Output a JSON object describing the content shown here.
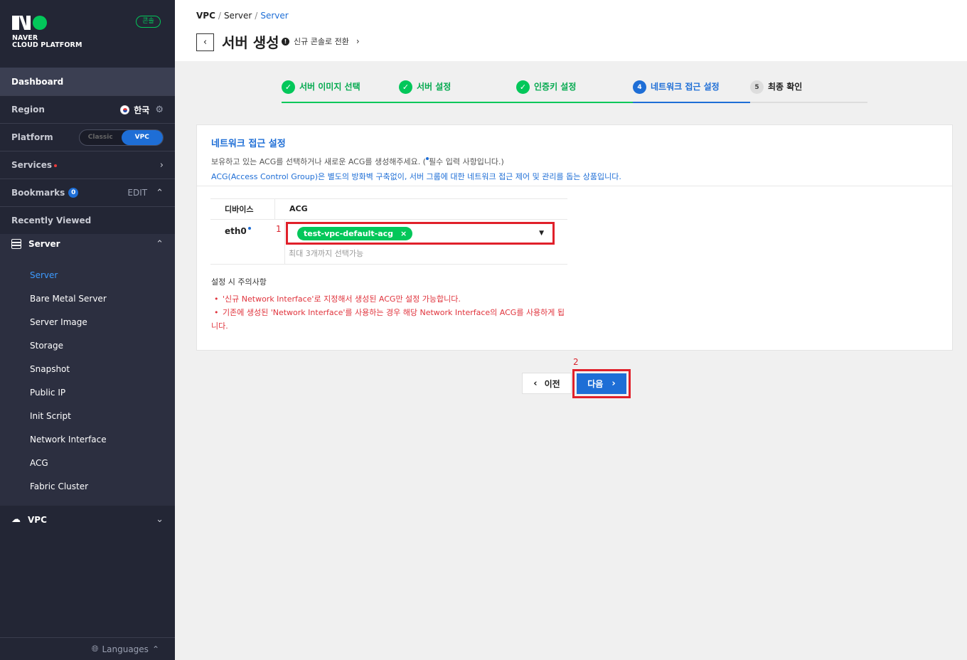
{
  "brand": {
    "line1": "NAVER",
    "line2": "CLOUD PLATFORM",
    "console_badge": "콘솔"
  },
  "sidebar": {
    "dashboard": "Dashboard",
    "region_label": "Region",
    "region_value": "한국",
    "platform_label": "Platform",
    "platform_options": [
      "Classic",
      "VPC"
    ],
    "platform_selected": "VPC",
    "services_label": "Services",
    "bookmarks_label": "Bookmarks",
    "bookmarks_count": "0",
    "bookmarks_edit": "EDIT",
    "recently_viewed": "Recently Viewed",
    "server_group": "Server",
    "server_items": [
      "Server",
      "Bare Metal Server",
      "Server Image",
      "Storage",
      "Snapshot",
      "Public IP",
      "Init Script",
      "Network Interface",
      "ACG",
      "Fabric Cluster"
    ],
    "server_active": "Server",
    "vpc_group": "VPC",
    "languages": "Languages"
  },
  "header": {
    "breadcrumb": [
      "VPC",
      "Server",
      "Server"
    ],
    "title": "서버 생성",
    "switch_console": "신규 콘솔로 전환"
  },
  "stepper": {
    "steps": [
      {
        "num": "1",
        "label": "서버 이미지 선택",
        "state": "done"
      },
      {
        "num": "2",
        "label": "서버 설정",
        "state": "done"
      },
      {
        "num": "3",
        "label": "인증키 설정",
        "state": "done"
      },
      {
        "num": "4",
        "label": "네트워크 접근 설정",
        "state": "current"
      },
      {
        "num": "5",
        "label": "최종 확인",
        "state": "todo"
      }
    ]
  },
  "card": {
    "title": "네트워크 접근 설정",
    "desc1_a": "보유하고 있는 ACG를 선택하거나 새로운 ACG를 생성해주세요. (",
    "desc1_b": "필수 입력 사항입니다.)",
    "desc2": "ACG(Access Control Group)은 별도의 방화벽 구축없이, 서버 그룹에 대한 네트워크 접근 제어 및 관리를 돕는 상품입니다.",
    "table": {
      "col_device": "디바이스",
      "col_acg": "ACG",
      "device": "eth0",
      "selected_acg": "test-vpc-default-acg",
      "hint": "최대 3개까지 선택가능"
    },
    "notes": {
      "title": "설정 시 주의사항",
      "items": [
        "'신규 Network Interface'로 지정해서 생성된 ACG만 설정 가능합니다.",
        "기존에 생성된 'Network Interface'를 사용하는 경우 해당 Network Interface의 ACG를 사용하게 됩니다."
      ]
    }
  },
  "annotations": {
    "marker1": "1",
    "marker2": "2"
  },
  "buttons": {
    "prev": "이전",
    "next": "다음"
  },
  "colors": {
    "sidebar_bg": "#232635",
    "accent_blue": "#1e6ed6",
    "brand_green": "#03c75a",
    "highlight_red": "#e0202a"
  }
}
